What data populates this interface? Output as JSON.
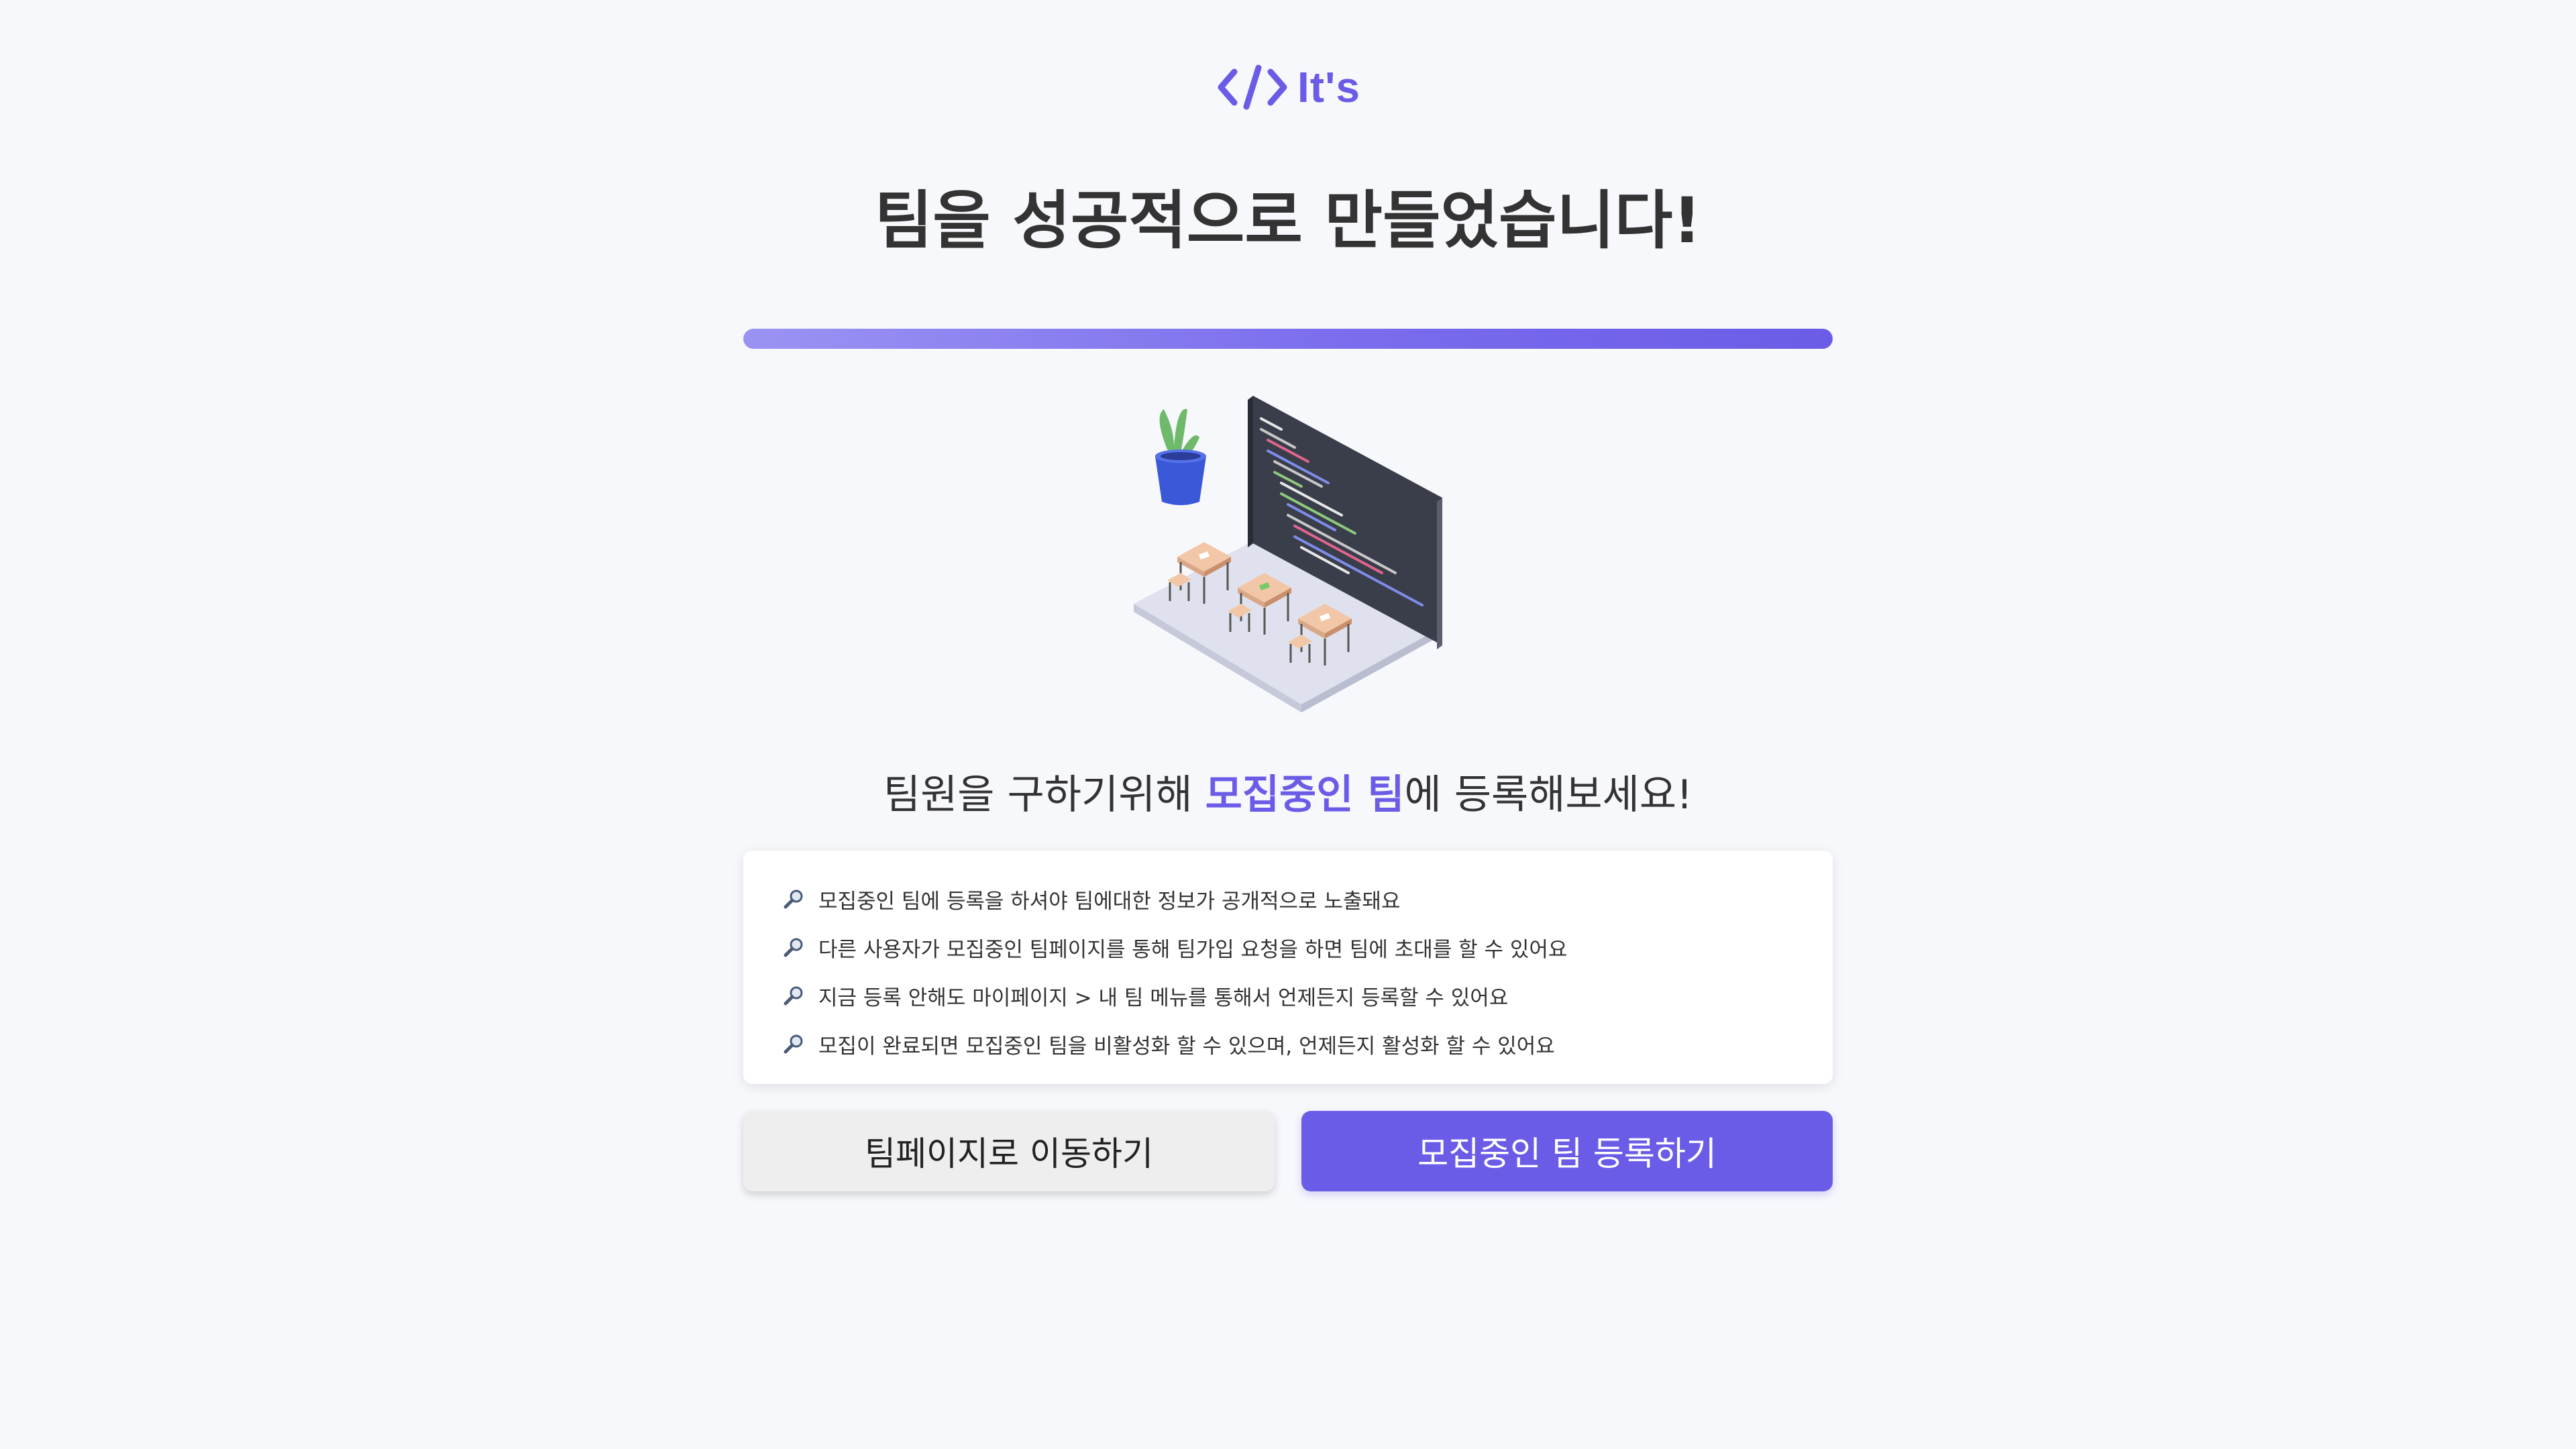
{
  "logo": {
    "text": "It's",
    "icon": "code-brackets-icon"
  },
  "page": {
    "title": "팀을 성공적으로 만들었습니다!"
  },
  "progress": {
    "value": 1.0
  },
  "illustration": {
    "icon": "classroom-illustration"
  },
  "subtitle": {
    "prefix": "팀원을 구하기위해 ",
    "highlight": "모집중인 팀",
    "suffix": "에 등록해보세요!"
  },
  "info": {
    "icon": "magnifier-icon",
    "items": [
      "모집중인 팀에 등록을 하셔야 팀에대한 정보가 공개적으로 노출돼요",
      "다른 사용자가 모집중인 팀페이지를 통해 팀가입 요청을 하면 팀에 초대를 할 수 있어요",
      "지금 등록 안해도 마이페이지 > 내 팀 메뉴를 통해서 언제든지 등록할 수 있어요",
      "모집이 완료되면 모집중인 팀을 비활성화 할 수 있으며, 언제든지 활성화 할 수 있어요"
    ]
  },
  "buttons": {
    "go_team_page": "팀페이지로 이동하기",
    "register_recruiting": "모집중인 팀 등록하기"
  },
  "colors": {
    "accent": "#6b5ce7",
    "background": "#f7f8fc",
    "text": "#333333",
    "secondary_button": "#eeeeee"
  }
}
